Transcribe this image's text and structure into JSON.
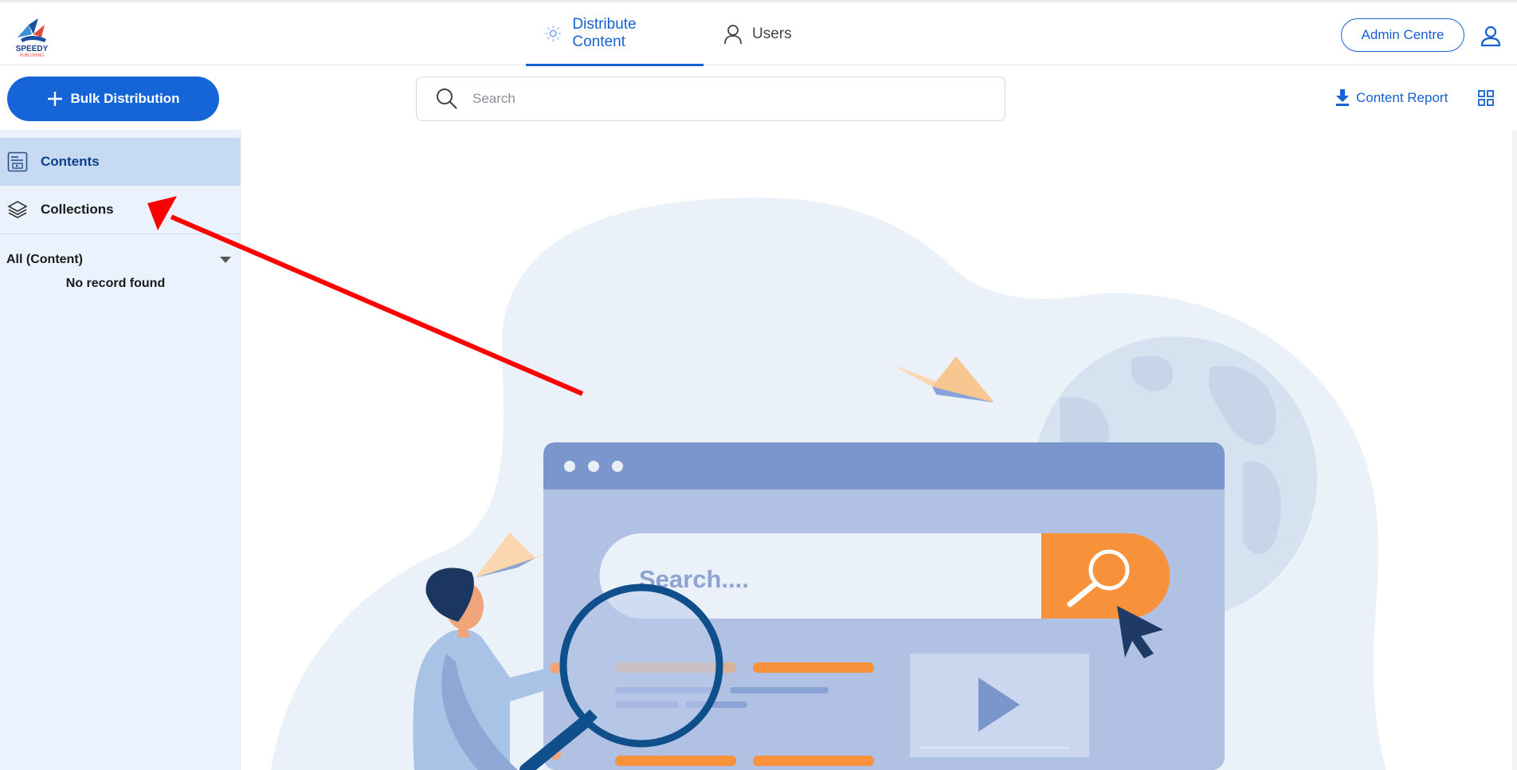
{
  "brand": {
    "logo_text": "SPEEDY",
    "logo_subtext": "PUBLISHING"
  },
  "nav": {
    "tabs": [
      {
        "label": "Distribute Content",
        "icon": "distribute-icon",
        "active": true
      },
      {
        "label": "Users",
        "icon": "user-icon",
        "active": false
      }
    ],
    "admin_label": "Admin Centre"
  },
  "toolbar": {
    "bulk_label": "Bulk Distribution",
    "search_placeholder": "Search",
    "report_label": "Content Report"
  },
  "sidebar": {
    "items": [
      {
        "label": "Contents",
        "icon": "contents-icon",
        "active": true
      },
      {
        "label": "Collections",
        "icon": "layers-icon",
        "active": false
      }
    ],
    "filter_label": "All (Content)",
    "empty_message": "No record found"
  },
  "illustration": {
    "search_text": "Search...."
  },
  "colors": {
    "primary": "#1565d8",
    "sidebar_bg": "#eaf3fd",
    "sidebar_active": "#c6daf3",
    "annotation_arrow": "#ff0000",
    "illustration_orange": "#f7923a",
    "illustration_window": "#7a96cc"
  }
}
